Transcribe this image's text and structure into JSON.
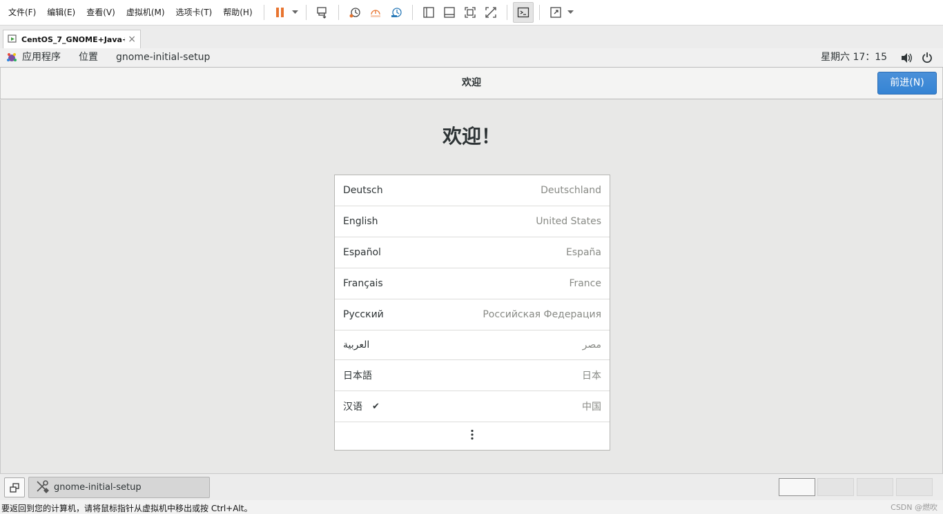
{
  "menubar": {
    "items": [
      "文件(F)",
      "编辑(E)",
      "查看(V)",
      "虚拟机(M)",
      "选项卡(T)",
      "帮助(H)"
    ]
  },
  "toolbar": {
    "icons": [
      "pause-icon",
      "dropdown-caret-icon",
      "send-ctrl-alt-del-icon",
      "snapshot-icon",
      "revert-snapshot-icon",
      "snapshot-manager-icon",
      "single-window-icon",
      "library-icon",
      "full-screen-icon",
      "unity-icon",
      "console-view-icon",
      "stretch-icon"
    ],
    "accent": "#e8742f"
  },
  "vm_tab": {
    "title": "CentOS_7_GNOME+Java+...",
    "close": "×"
  },
  "gnome_topbar": {
    "applications": "应用程序",
    "places": "位置",
    "app_name": "gnome-initial-setup",
    "clock": "星期六 17：15"
  },
  "header": {
    "title": "欢迎",
    "next_label": "前进(N)",
    "next_color": "#3584d4"
  },
  "main": {
    "heading": "欢迎！",
    "languages": [
      {
        "name": "Deutsch",
        "region": "Deutschland",
        "selected": false
      },
      {
        "name": "English",
        "region": "United States",
        "selected": false
      },
      {
        "name": "Español",
        "region": "España",
        "selected": false
      },
      {
        "name": "Français",
        "region": "France",
        "selected": false
      },
      {
        "name": "Русский",
        "region": "Российская Федерация",
        "selected": false
      },
      {
        "name": "العربية",
        "region": "مصر",
        "selected": false
      },
      {
        "name": "日本語",
        "region": "日本",
        "selected": false
      },
      {
        "name": "汉语",
        "region": "中国",
        "selected": true
      }
    ],
    "check_mark": "✔",
    "more_icon": "⋮"
  },
  "taskbar": {
    "window_label": "gnome-initial-setup",
    "workspaces": 4,
    "active_workspace": 1
  },
  "statusbar": {
    "text": "要返回到您的计算机，请将鼠标指针从虚拟机中移出或按 Ctrl+Alt。",
    "watermark": "CSDN @燃吹"
  }
}
